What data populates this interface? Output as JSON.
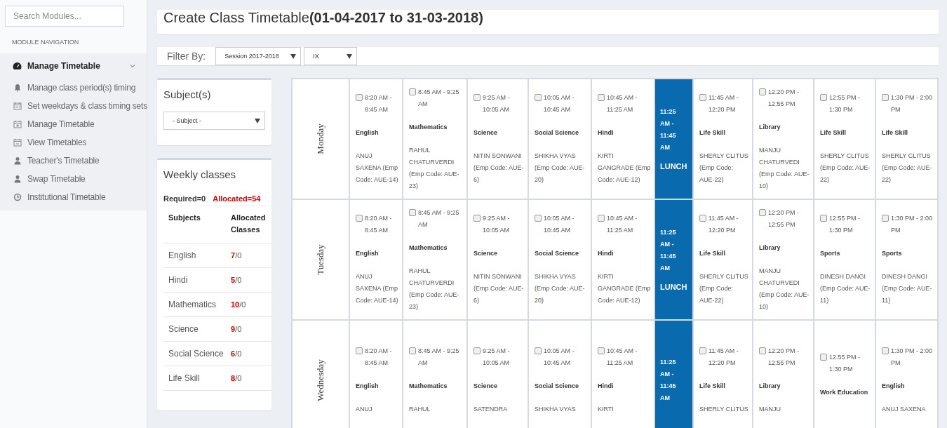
{
  "sidebar": {
    "search": {
      "placeholder": "Search Modules..."
    },
    "heading": "MODULE NAVIGATION",
    "group": {
      "label": "Manage Timetable",
      "expanded": true,
      "items": [
        {
          "label": "Manage class period(s) timing"
        },
        {
          "label": "Set weekdays & class timing sets"
        },
        {
          "label": "Manage Timetable"
        },
        {
          "label": "View Timetables"
        },
        {
          "label": "Teacher's Timetable"
        },
        {
          "label": "Swap Timetable"
        },
        {
          "label": "Institutional Timetable"
        }
      ]
    }
  },
  "page_title": "Create Class Timetable**(01-04-2017 to 31-03-2018)**",
  "filter": {
    "label": "Filter By:",
    "session": "Session 2017-2018",
    "class": "IX"
  },
  "subjects_card": {
    "title": "Subject(s)",
    "select": "- Subject -"
  },
  "weekly_card": {
    "title": "Weekly classes",
    "required": "Required=0",
    "allocated": "Allocated=54",
    "columns": [
      "Subjects",
      "Allocated Classes"
    ],
    "rows": [
      {
        "subject": "English",
        "allocated": "7",
        "required": "/0"
      },
      {
        "subject": "Hindi",
        "allocated": "5",
        "required": "/0"
      },
      {
        "subject": "Mathematics",
        "allocated": "10",
        "required": "/0"
      },
      {
        "subject": "Science",
        "allocated": "9",
        "required": "/0"
      },
      {
        "subject": "Social Science",
        "allocated": "6",
        "required": "/0"
      },
      {
        "subject": "Life Skill",
        "allocated": "8",
        "required": "/0"
      }
    ]
  },
  "timetable": [
    {
      "day": "Monday",
      "slots": [
        {
          "kind": "period",
          "checked": false,
          "time": "8:20 AM - 8:45 AM",
          "subject": "English",
          "teacher": "ANUJ SAXENA (Emp Code: AUE-14)"
        },
        {
          "kind": "period",
          "checked": false,
          "time": "8:45 AM - 9:25 AM",
          "subject": "Mathematics",
          "teacher": "RAHUL CHATURVERDI (Emp Code: AUE-23)"
        },
        {
          "kind": "period",
          "checked": false,
          "time": "9:25 AM - 10:05 AM",
          "subject": "Science",
          "teacher": "NITIN SONWANI (Emp Code: AUE-6)"
        },
        {
          "kind": "period",
          "checked": false,
          "time": "10:05 AM - 10:45 AM",
          "subject": "Social Science",
          "teacher": "SHIKHA VYAS (Emp Code: AUE-20)"
        },
        {
          "kind": "period",
          "checked": false,
          "time": "10:45 AM - 11:25 AM",
          "subject": "Hindi",
          "teacher": "KIRTI GANGRADE (Emp Code: AUE-12)"
        },
        {
          "kind": "break",
          "time": "11:25 AM - 11:45 AM",
          "label": "LUNCH"
        },
        {
          "kind": "period",
          "checked": false,
          "time": "11:45 AM - 12:20 PM",
          "subject": "Life Skill",
          "teacher": "SHERLY CLITUS (Emp Code: AUE-22)"
        },
        {
          "kind": "period",
          "checked": false,
          "time": "12:20 PM - 12:55 PM",
          "subject": "Library",
          "teacher": "MANJU CHATURVEDI (Emp Code: AUE-10)"
        },
        {
          "kind": "period",
          "checked": false,
          "time": "12:55 PM - 1:30 PM",
          "subject": "Life Skill",
          "teacher": "SHERLY CLITUS (Emp Code: AUE-22)"
        },
        {
          "kind": "period",
          "checked": false,
          "time": "1:30 PM - 2:00 PM",
          "subject": "Life Skill",
          "teacher": "SHERLY CLITUS (Emp Code: AUE-22)"
        }
      ]
    },
    {
      "day": "Tuesday",
      "slots": [
        {
          "kind": "period",
          "checked": false,
          "time": "8:20 AM - 8:45 AM",
          "subject": "English",
          "teacher": "ANUJ SAXENA (Emp Code: AUE-14)"
        },
        {
          "kind": "period",
          "checked": false,
          "time": "8:45 AM - 9:25 AM",
          "subject": "Mathematics",
          "teacher": "RAHUL CHATURVERDI (Emp Code: AUE-23)"
        },
        {
          "kind": "period",
          "checked": false,
          "time": "9:25 AM - 10:05 AM",
          "subject": "Science",
          "teacher": "NITIN SONWANI (Emp Code: AUE-6)"
        },
        {
          "kind": "period",
          "checked": false,
          "time": "10:05 AM - 10:45 AM",
          "subject": "Social Science",
          "teacher": "SHIKHA VYAS (Emp Code: AUE-20)"
        },
        {
          "kind": "period",
          "checked": false,
          "time": "10:45 AM - 11:25 AM",
          "subject": "Hindi",
          "teacher": "KIRTI GANGRADE (Emp Code: AUE-12)"
        },
        {
          "kind": "break",
          "time": "11:25 AM - 11:45 AM",
          "label": "LUNCH"
        },
        {
          "kind": "period",
          "checked": false,
          "time": "11:45 AM - 12:20 PM",
          "subject": "Life Skill",
          "teacher": "SHERLY CLITUS (Emp Code: AUE-22)"
        },
        {
          "kind": "period",
          "checked": false,
          "time": "12:20 PM - 12:55 PM",
          "subject": "Library",
          "teacher": "MANJU CHATURVEDI (Emp Code: AUE-10)"
        },
        {
          "kind": "period",
          "checked": false,
          "time": "12:55 PM - 1:30 PM",
          "subject": "Sports",
          "teacher": "DINESH DANGI (Emp Code: AUE-11)"
        },
        {
          "kind": "period",
          "checked": false,
          "time": "1:30 PM - 2:00 PM",
          "subject": "Sports",
          "teacher": "DINESH DANGI (Emp Code: AUE-11)"
        }
      ]
    },
    {
      "day": "Wednesday",
      "slots": [
        {
          "kind": "period",
          "checked": false,
          "time": "8:20 AM - 8:45 AM",
          "subject": "English",
          "teacher": "ANUJ"
        },
        {
          "kind": "period",
          "checked": false,
          "time": "8:45 AM - 9:25 AM",
          "subject": "Mathematics",
          "teacher": "RAHUL"
        },
        {
          "kind": "period",
          "checked": false,
          "time": "9:25 AM - 10:05 AM",
          "subject": "Science",
          "teacher": "SATENDRA"
        },
        {
          "kind": "period",
          "checked": false,
          "time": "10:05 AM - 10:45 AM",
          "subject": "Social Science",
          "teacher": "SHIKHA VYAS"
        },
        {
          "kind": "period",
          "checked": false,
          "time": "10:45 AM - 11:25 AM",
          "subject": "Hindi",
          "teacher": "KIRTI"
        },
        {
          "kind": "break",
          "time": "11:25 AM - 11:45 AM"
        },
        {
          "kind": "period",
          "checked": false,
          "time": "11:45 AM - 12:20 PM",
          "subject": "Life Skill",
          "teacher": "SHERLY CLITUS"
        },
        {
          "kind": "period",
          "checked": false,
          "time": "12:20 PM - 12:55 PM",
          "subject": "Library",
          "teacher": "MANJU"
        },
        {
          "kind": "period",
          "checked": false,
          "time": "12:55 PM - 1:30 PM",
          "subject": "Work Education"
        },
        {
          "kind": "period",
          "checked": false,
          "time": "1:30 PM - 2:00 PM",
          "subject": "English",
          "teacher": "ANUJ SAXENA"
        }
      ]
    }
  ]
}
